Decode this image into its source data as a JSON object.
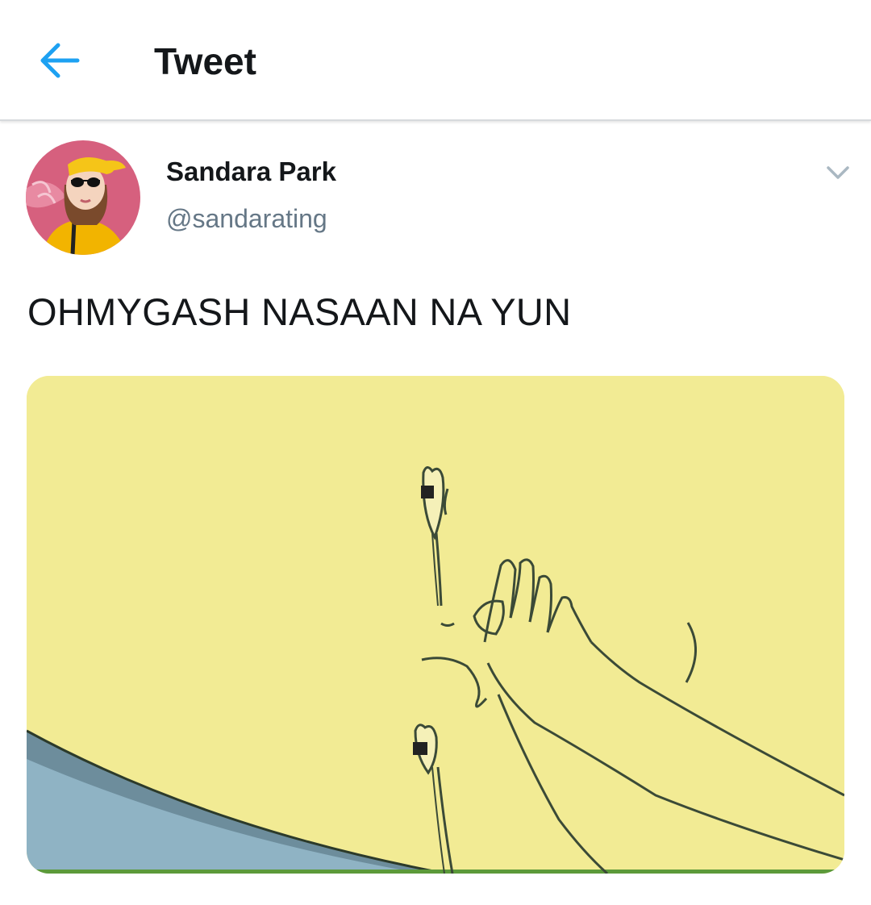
{
  "header": {
    "title": "Tweet",
    "back_icon": "back-arrow-icon",
    "accent_color": "#1da1f2"
  },
  "tweet": {
    "author": {
      "display_name": "Sandara Park",
      "handle": "@sandarating",
      "avatar": "profile-photo"
    },
    "menu_icon": "chevron-down-icon",
    "text": "OHMYGASH NASAAN NA YUN",
    "media": {
      "type": "image",
      "subject": "cartoon-illustration"
    }
  }
}
